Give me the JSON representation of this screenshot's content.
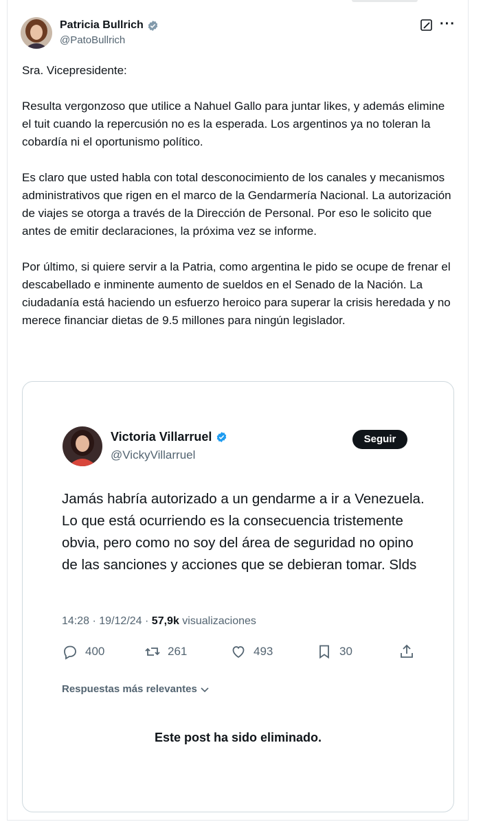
{
  "author": {
    "name": "Patricia Bullrich",
    "handle": "@PatoBullrich",
    "verified": true,
    "avatar_icon": "avatar-photo"
  },
  "header_actions": {
    "edit_icon": "edit-icon",
    "more_icon": "more-icon",
    "more_label": "···"
  },
  "tweet": {
    "paragraphs": [
      "Sra. Vicepresidente:",
      "Resulta vergonzoso que utilice a Nahuel Gallo para juntar likes, y además elimine el tuit cuando la repercusión no es la esperada. Los argentinos ya no toleran la cobardía ni el oportunismo político.",
      "Es claro que usted habla con total desconocimiento de los canales y mecanismos administrativos que rigen en el marco de la Gendarmería Nacional. La autorización de viajes se otorga a través de la Dirección de Personal. Por eso le solicito que antes de emitir declaraciones, la próxima vez se informe.",
      "Por último, si quiere servir a la Patria, como argentina le pido se ocupe de frenar el descabellado e inminente aumento de sueldos en el Senado de la Nación. La ciudadanía está haciendo un esfuerzo heroico para superar la crisis heredada y no merece financiar dietas de 9.5 millones para ningún legislador."
    ]
  },
  "quote": {
    "name": "Victoria Villarruel",
    "handle": "@VickyVillarruel",
    "verified": true,
    "follow_label": "Seguir",
    "text": "Jamás habría autorizado a un gendarme a ir a Venezuela. Lo que está ocurriendo es la consecuencia tristemente obvia, pero como no soy del área de seguridad no opino de las sanciones y acciones que se debieran tomar. Slds",
    "time": "14:28",
    "date": "19/12/24",
    "views_count": "57,9k",
    "views_label": "visualizaciones",
    "separator": "·",
    "actions": {
      "replies": "400",
      "reposts": "261",
      "likes": "493",
      "bookmarks": "30"
    },
    "replies_sort_label": "Respuestas más relevantes",
    "deleted_notice": "Este post ha sido eliminado."
  },
  "colors": {
    "text_primary": "#0f1419",
    "text_secondary": "#536471",
    "verified_blue": "#1d9bf0",
    "border": "#cfd9de"
  }
}
